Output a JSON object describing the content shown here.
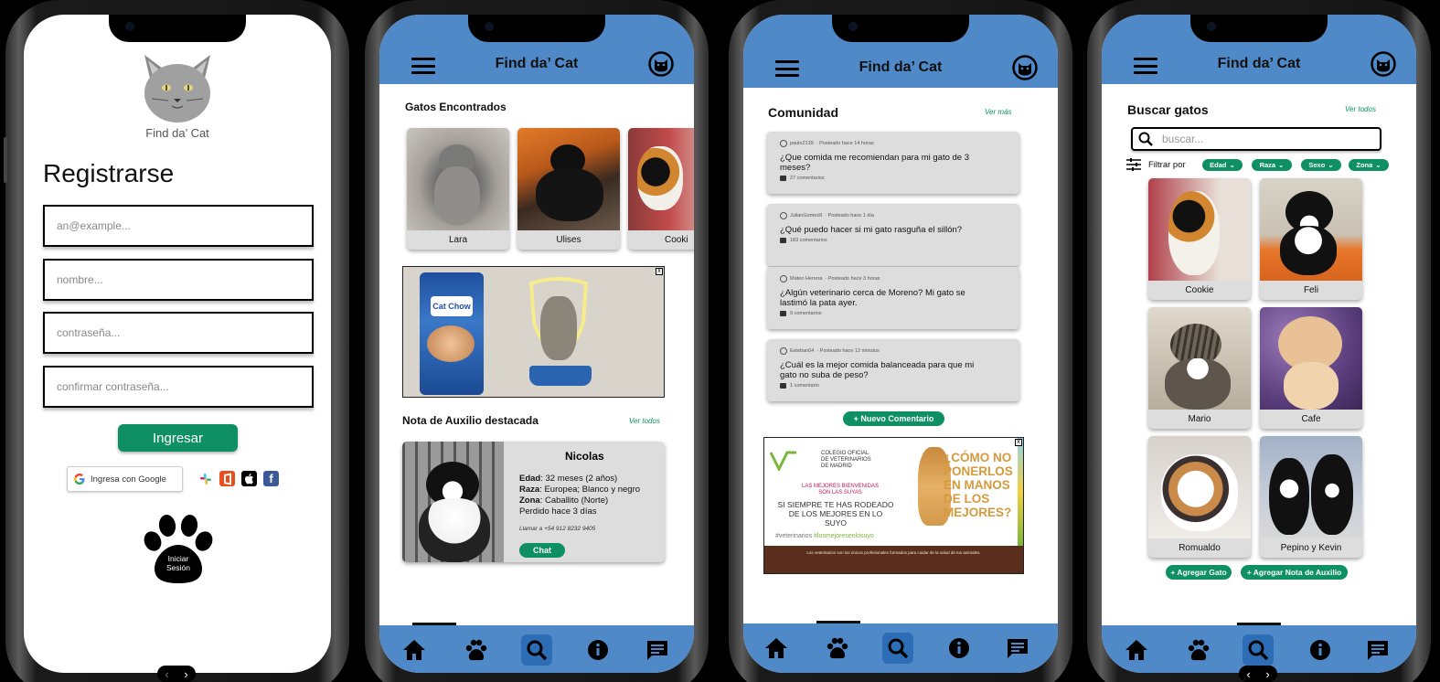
{
  "register": {
    "logo_label": "Find da’ Cat",
    "title": "Registrarse",
    "email_placeholder": "an@example...",
    "name_placeholder": "nombre...",
    "password_placeholder": "contraseña...",
    "confirm_placeholder": "confirmar contraseña...",
    "submit_label": "Ingresar",
    "google_label": "Ingresa con Google",
    "login_label_1": "Iniciar",
    "login_label_2": "Sesión",
    "pager_prev": "‹",
    "pager_next": "›"
  },
  "app": {
    "title": "Find da’ Cat"
  },
  "home": {
    "found_title": "Gatos Encontrados",
    "found_cats": [
      "Lara",
      "Ulises",
      "Cooki"
    ],
    "aid_title": "Nota de Auxilio destacada",
    "aid_ver": "Ver todos",
    "aid_card": {
      "name": "Nicolas",
      "edad_label": "Edad",
      "edad": ": 32 meses (2 años)",
      "raza_label": "Raza",
      "raza": ": Europea; Blanco y negro",
      "zona_label": "Zona",
      "zona": ": Caballito (Norte)",
      "lost": "Perdido hace 3 días",
      "phone": "Llamar a +54 912 8232 9405",
      "chat": "Chat"
    },
    "ad_brand": "Cat Chow",
    "ad_close": "x"
  },
  "community": {
    "title": "Comunidad",
    "ver": "Ver más",
    "posts": [
      {
        "user": "paulo2139",
        "time": "· Posteado hace 14 horas",
        "question": "¿Que comida me recomiendan para mi gato de 3 meses?",
        "comments": "27 comentarios"
      },
      {
        "user": "JulianGomez8",
        "time": "· Posteado hace 1 día",
        "question": "¿Qué puedo hacer si mi gato rasguña el sillón?",
        "comments": "183 comentarios"
      },
      {
        "user": "Mateo Herrera",
        "time": "· Posteado hace 3 horas",
        "question": "¿Algún veterinario cerca de Moreno? Mi gato se lastimó la pata ayer.",
        "comments": "9 comentarios"
      },
      {
        "user": "Esteban04",
        "time": "· Posteado hace 12 minutos",
        "question": "¿Cuál es la mejor comida balanceada para que mi gato no suba de peso?",
        "comments": "1 comentario"
      }
    ],
    "new_comment": "+ Nuevo Comentario",
    "ad": {
      "org1": "COLEGIO OFICIAL",
      "org2": "DE VETERINARIOS",
      "org3": "DE MADRID",
      "tag1": "LAS MEJORES BIENVENIDAS",
      "tag2": "SON LAS SUYAS",
      "line1": "SI SIEMPRE TE HAS RODEADO",
      "line2": "DE LOS MEJORES EN LO SUYO",
      "big": "¿CÓMO NO PONERLOS EN MANOS DE LOS MEJORES?",
      "hashtag1": "#veterinarios",
      "hashtag2": "#losmejoresenlosuyo",
      "footer": "Los veterinarios son los únicos profesionales formados para cuidar de la salud de tus animales."
    }
  },
  "search": {
    "title": "Buscar gatos",
    "ver": "Ver todos",
    "placeholder": "buscar...",
    "filter_label": "Filtrar por",
    "chips": [
      "Edad",
      "Raza",
      "Sexo",
      "Zona"
    ],
    "cats": [
      "Cookie",
      "Feli",
      "Mario",
      "Cafe",
      "Romualdo",
      "Pepino y Kevin"
    ],
    "add_cat": "+ Agregar Gato",
    "add_note": "+ Agregar Nota de Auxilio"
  },
  "colors": {
    "appbar": "#4f89c7",
    "accent_green": "#0f8f64",
    "nav_active": "#2c6db5"
  }
}
